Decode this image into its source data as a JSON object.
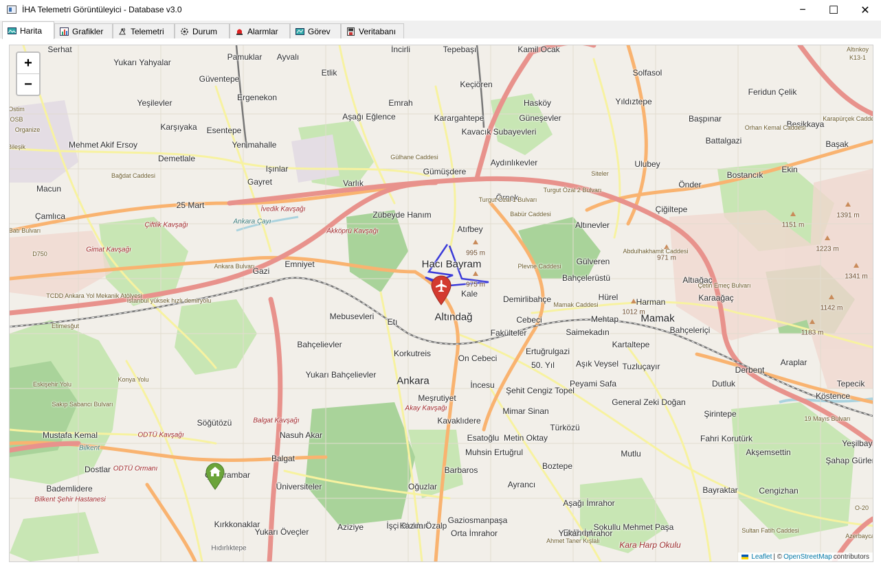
{
  "window": {
    "title": "İHA Telemetri Görüntüleyici - Database v3.0",
    "minimize_icon": "−",
    "maximize_icon": "☐",
    "close_icon": "✕"
  },
  "tabs": [
    {
      "label": "Harita",
      "icon": "map-icon",
      "active": true
    },
    {
      "label": "Grafikler",
      "icon": "chart-icon",
      "active": false
    },
    {
      "label": "Telemetri",
      "icon": "telemetry-icon",
      "active": false
    },
    {
      "label": "Durum",
      "icon": "gear-icon",
      "active": false
    },
    {
      "label": "Alarmlar",
      "icon": "alarm-bell-icon",
      "active": false
    },
    {
      "label": "Görev",
      "icon": "mission-icon",
      "active": false
    },
    {
      "label": "Veritabanı",
      "icon": "database-icon",
      "active": false
    }
  ],
  "map": {
    "zoom_in": "+",
    "zoom_out": "−",
    "attribution": {
      "leaflet": "Leaflet",
      "separator": " | © ",
      "osm": "OpenStreetMap",
      "contributors": " contributors"
    },
    "colors": {
      "drone_marker": "#d33a2f",
      "home_marker": "#6ba43a",
      "flight_path": "#3b3bd9",
      "motorway": "#e8928c",
      "primary_road": "#f9b370"
    },
    "places": [
      "Serhat",
      "Yukarı Yahyalar",
      "Pamuklar",
      "Ayvalı",
      "Etlik",
      "İncirli",
      "Tepebaşı",
      "Kamil Ocak",
      "Güventepe",
      "Ergenekon",
      "Keçiören",
      "Solfasol",
      "Yeşilevler",
      "Emrah",
      "Hasköy",
      "Yıldıztepe",
      "Feridun Çelik",
      "Karşıyaka",
      "Esentepe",
      "Aşağı Eğlence",
      "Karargahtepe",
      "Güneşevler",
      "Başpınar",
      "Beşikkaya",
      "Mehmet Akif Ersoy",
      "Yenimahalle",
      "Kavacık Subayevleri",
      "Battalgazi",
      "Başak",
      "Demetlale",
      "Işınlar",
      "Gümüşdere",
      "Aydınlıkevler",
      "Ulubey",
      "Ekin",
      "Macun",
      "Gayret",
      "Varlık",
      "Bostancık",
      "Önder",
      "25 Mart",
      "Zübeyde Hanım",
      "Örnek",
      "Çiğiltepe",
      "Çamlıca",
      "Atıfbey",
      "Altınevler",
      "Hacı Bayram",
      "Gülveren",
      "Emniyet",
      "Gazi",
      "Kale",
      "Bahçelerüstü",
      "Altıağaç",
      "Karaağaç",
      "Demirlibahçe",
      "Hürel",
      "Harman",
      "Mamak",
      "Mebusevleri",
      "Etı",
      "Altındağ",
      "Cebeci",
      "Mehtap",
      "Saimekadın",
      "Kartaltepe",
      "Bahçeleriçi",
      "Fakülteler",
      "Bahçelievler",
      "Korkutreis",
      "Ertuğrulgazi",
      "Araplar",
      "On Cebeci",
      "50. Yıl",
      "Aşık Veysel",
      "Tuzluçayır",
      "Derbent",
      "Yukarı Bahçelievler",
      "Ankara",
      "İncesu",
      "Şehit Cengiz Topel",
      "Peyami Safa",
      "Dutluk",
      "Tepecik",
      "Meşrutiyet",
      "General Zeki Doğan",
      "Köstence",
      "Söğütözü",
      "Kavaklıdere",
      "Mimar Sinan",
      "Şirintepe",
      "Mustafa Kemal",
      "Nasuh Akar",
      "Esatoğlu",
      "Metin Oktay",
      "Türközü",
      "Fahri Korutürk",
      "Yeşilbayır",
      "Muhsin Ertuğrul",
      "Mutlu",
      "Akşemsettin",
      "Balgat",
      "Şahap Gürler",
      "Çukurambar",
      "Barbaros",
      "Boztepe",
      "Dostlar",
      "Üniversiteler",
      "Oğuzlar",
      "Ayrancı",
      "Bayraktar",
      "Aşağı İmrahor",
      "Cengizhan",
      "Gaziosmanpaşa",
      "Bademlidere",
      "İşçi Blokları",
      "Sokullu Mehmet Paşa",
      "Aziziye",
      "Kazım Özalp",
      "Orta İmrahor",
      "Ehlibeyt",
      "Kırkkonaklar",
      "Yukarı Öveçler",
      "Yukarı İmrahor",
      "Kara Harp Okulu",
      "Hıdırlıktepe"
    ],
    "elevations": [
      "995 m",
      "971 m",
      "975 m",
      "1151 m",
      "1391 m",
      "1223 m",
      "1341 m",
      "1142 m",
      "1183 m",
      "1012 m"
    ],
    "roads": [
      "Turgut Özal 1 Bulvarı",
      "Turgut Özal 2 Bulvarı",
      "İvedik Kavşağı",
      "Akköprü Kavşağı",
      "Gimat Kavşağı",
      "Çiftlik Kavşağı",
      "Bağdat Caddesi",
      "Batı Bulvarı",
      "Ankara Bulvarı",
      "İstanbul yüksek hızlı demiryolu",
      "TCDD Ankara Yol Mekanik Atölyesi",
      "Etimesğut",
      "Ankara Çayı",
      "Gülhane Caddesi",
      "Babür Caddesi",
      "Plevne Caddesi",
      "Mamak Caddesi",
      "Akay Kavşağı",
      "Balgat Kavşağı",
      "ODTÜ Kavşağı",
      "Bilkent",
      "ODTÜ Ormanı",
      "Bilkent Şehir Hastanesi",
      "Sakıp Sabancı Bulvarı",
      "Eskişehir Yolu",
      "19 Mayıs Bulvarı",
      "Siteler",
      "D750",
      "O-20",
      "K13-1",
      "Altınkoy",
      "Organize",
      "Sultan Fatih Caddesi",
      "Ostim",
      "OSB",
      "Bileşik",
      "Orhan Kemal Caddesi",
      "Karapürçek Caddesi",
      "Abdulhakhamit Caddesi",
      "Çetin Emeç Bulvarı",
      "Konya Yolu",
      "Azerbaycan",
      "Ahmet Taner Kışlalı"
    ]
  }
}
